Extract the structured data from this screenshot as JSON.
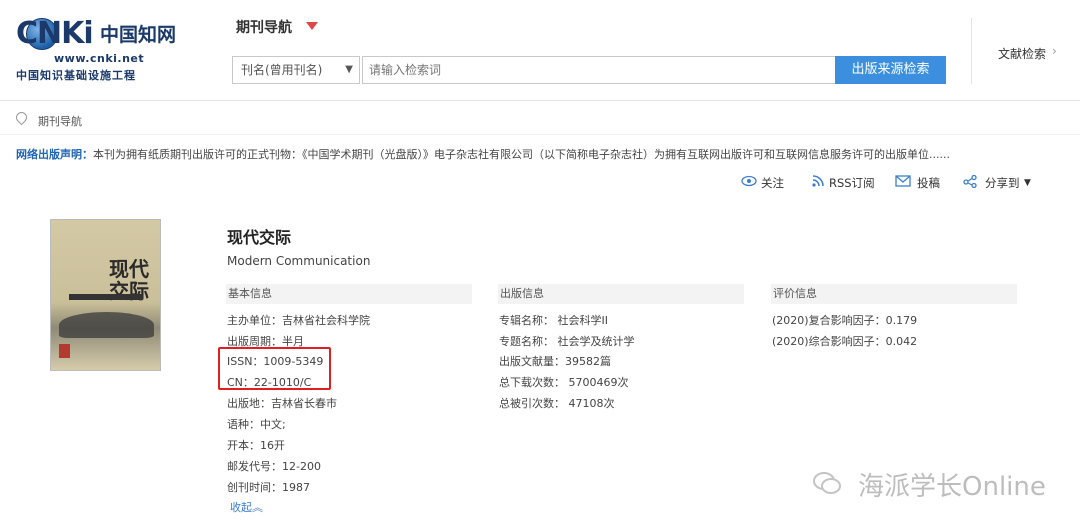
{
  "header": {
    "logo": {
      "main": "CNKi",
      "cn": "中国知网",
      "url": "www.cnki.net",
      "subtitle": "中国知识基础设施工程"
    },
    "nav_title": "期刊导航",
    "search": {
      "field_select": "刊名(曾用刊名)",
      "placeholder": "请输入检索词",
      "button": "出版来源检索"
    },
    "doc_search": "文献检索"
  },
  "breadcrumb": "期刊导航",
  "notice": {
    "label": "网络出版声明：",
    "text": "本刊为拥有纸质期刊出版许可的正式刊物：《中国学术期刊（光盘版）》电子杂志社有限公司（以下简称电子杂志社）为拥有互联网出版许可和互联网信息服务许可的出版单位......"
  },
  "actions": {
    "follow": "关注",
    "rss": "RSS订阅",
    "submit": "投稿",
    "share": "分享到"
  },
  "journal": {
    "title": "现代交际",
    "english": "Modern Communication",
    "cover_title": "现代交际",
    "basic": {
      "header": "基本信息",
      "rows": [
        "主办单位：吉林省社会科学院",
        "出版周期：半月",
        "ISSN：1009-5349",
        "CN：22-1010/C",
        "出版地：吉林省长春市",
        "语种：中文;",
        "开本：16开",
        "邮发代号：12-200",
        "创刊时间：1987"
      ],
      "collapse": "收起"
    },
    "publish": {
      "header": "出版信息",
      "rows": [
        "专辑名称：  社会科学II",
        "专题名称：  社会学及统计学",
        "出版文献量：39582篇",
        "总下载次数：  5700469次",
        "总被引次数：  47108次"
      ]
    },
    "evaluation": {
      "header": "评价信息",
      "rows": [
        "(2020)复合影响因子：0.179",
        "(2020)综合影响因子：0.042"
      ]
    }
  },
  "watermark": "海派学长Online"
}
